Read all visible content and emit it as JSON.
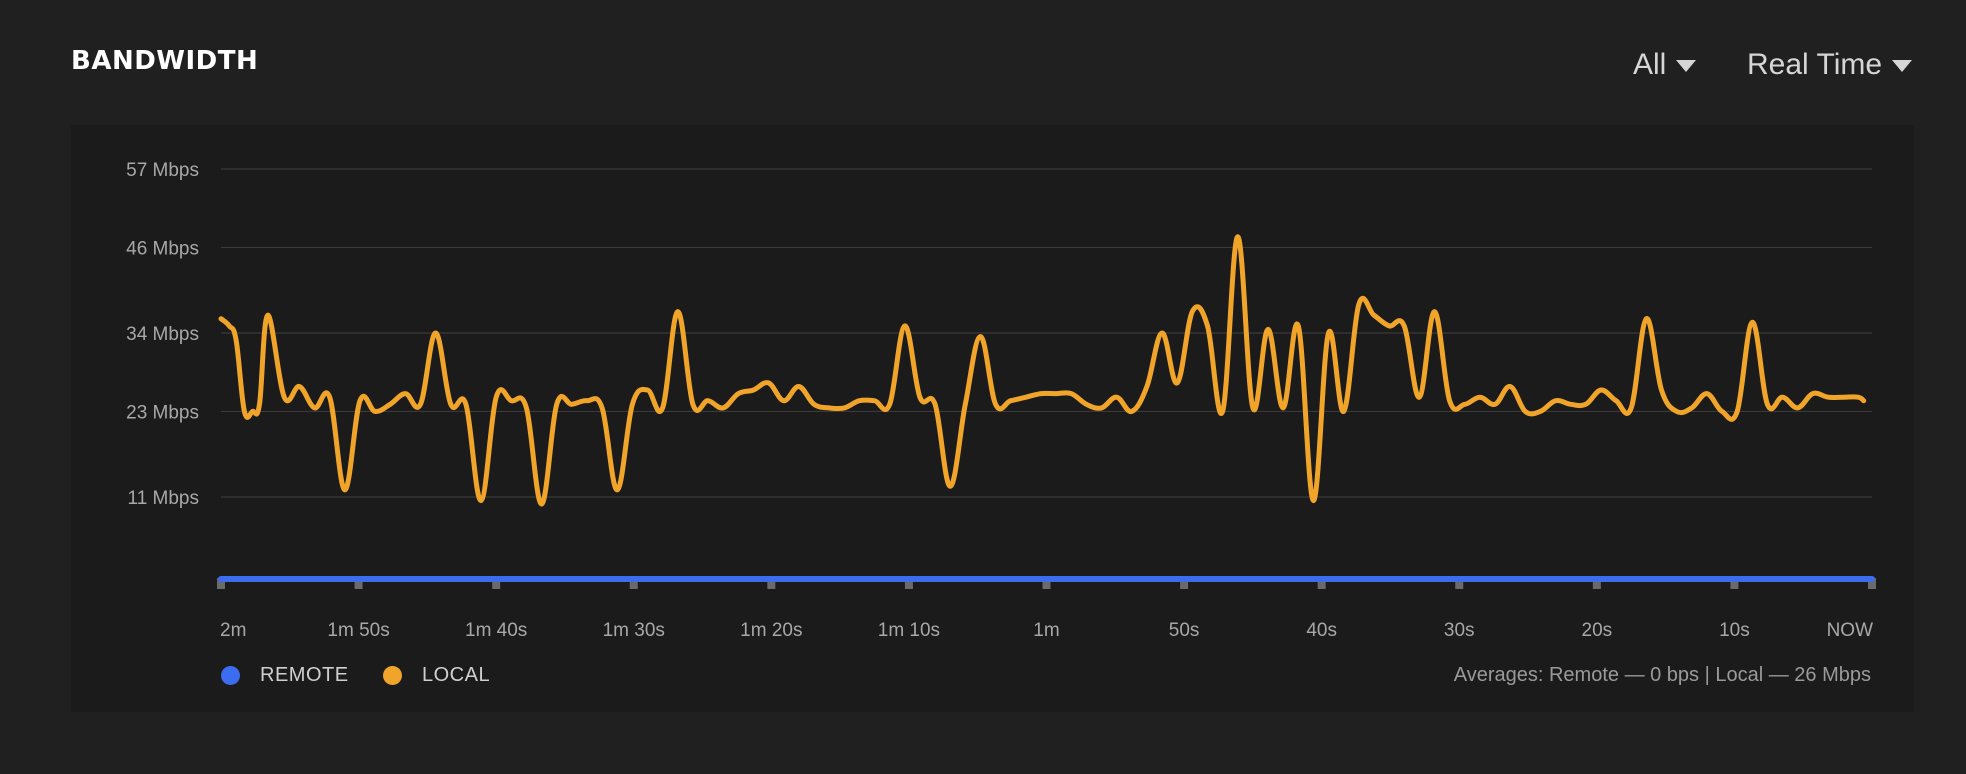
{
  "header": {
    "title": "BANDWIDTH",
    "filter_label": "All",
    "range_label": "Real Time"
  },
  "colors": {
    "remote": "#3c6df0",
    "local": "#f0a52a",
    "grid": "#3a3a3a",
    "tick_text": "#a8a8a8"
  },
  "footer": {
    "averages": "Averages: Remote — 0 bps | Local — 26 Mbps"
  },
  "chart_data": {
    "type": "line",
    "title": "BANDWIDTH",
    "xlabel": "",
    "ylabel": "",
    "x_range_seconds_ago": [
      120,
      0
    ],
    "ylim": [
      0,
      57
    ],
    "y_ticks": [
      {
        "value": 57,
        "label": "57 Mbps"
      },
      {
        "value": 46,
        "label": "46 Mbps"
      },
      {
        "value": 34,
        "label": "34 Mbps"
      },
      {
        "value": 23,
        "label": "23 Mbps"
      },
      {
        "value": 11,
        "label": "11 Mbps"
      }
    ],
    "x_ticks": [
      {
        "value": 120,
        "label": "2m"
      },
      {
        "value": 110,
        "label": "1m 50s"
      },
      {
        "value": 100,
        "label": "1m 40s"
      },
      {
        "value": 90,
        "label": "1m 30s"
      },
      {
        "value": 80,
        "label": "1m 20s"
      },
      {
        "value": 70,
        "label": "1m 10s"
      },
      {
        "value": 60,
        "label": "1m"
      },
      {
        "value": 50,
        "label": "50s"
      },
      {
        "value": 40,
        "label": "40s"
      },
      {
        "value": 30,
        "label": "30s"
      },
      {
        "value": 20,
        "label": "20s"
      },
      {
        "value": 10,
        "label": "10s"
      },
      {
        "value": 0,
        "label": "NOW"
      }
    ],
    "grid": true,
    "legend_position": "bottom-left",
    "series": [
      {
        "name": "REMOTE",
        "color": "#3c6df0",
        "values": [
          [
            120,
            0
          ],
          [
            0,
            0
          ]
        ]
      },
      {
        "name": "LOCAL",
        "color": "#f0a52a",
        "values": [
          [
            120,
            36
          ],
          [
            119.4,
            35
          ],
          [
            118.9,
            33
          ],
          [
            118.3,
            23
          ],
          [
            117.7,
            23
          ],
          [
            117.2,
            24
          ],
          [
            116.6,
            36.5
          ],
          [
            115.4,
            25
          ],
          [
            114.3,
            26.5
          ],
          [
            113.2,
            23.5
          ],
          [
            112.1,
            25
          ],
          [
            111,
            12
          ],
          [
            109.9,
            24.5
          ],
          [
            108.8,
            23
          ],
          [
            107.7,
            24
          ],
          [
            106.6,
            25.5
          ],
          [
            105.5,
            24
          ],
          [
            104.4,
            34
          ],
          [
            103.3,
            24
          ],
          [
            102.2,
            24
          ],
          [
            101.1,
            10.5
          ],
          [
            100,
            25
          ],
          [
            98.9,
            24.5
          ],
          [
            97.8,
            23.5
          ],
          [
            96.7,
            10
          ],
          [
            95.6,
            24
          ],
          [
            94.5,
            24
          ],
          [
            93.4,
            24.5
          ],
          [
            92.3,
            23.5
          ],
          [
            91.2,
            12
          ],
          [
            90.1,
            24
          ],
          [
            89,
            26
          ],
          [
            87.9,
            23.5
          ],
          [
            86.8,
            37
          ],
          [
            85.7,
            24
          ],
          [
            84.6,
            24.5
          ],
          [
            83.5,
            23.5
          ],
          [
            82.4,
            25.5
          ],
          [
            81.3,
            26
          ],
          [
            80.2,
            27
          ],
          [
            79.1,
            24.5
          ],
          [
            78,
            26.5
          ],
          [
            76.9,
            24
          ],
          [
            75.8,
            23.5
          ],
          [
            74.7,
            23.5
          ],
          [
            73.6,
            24.5
          ],
          [
            72.5,
            24.5
          ],
          [
            71.4,
            24
          ],
          [
            70.3,
            35
          ],
          [
            69.2,
            25
          ],
          [
            68.1,
            24
          ],
          [
            67,
            12.5
          ],
          [
            65.9,
            24
          ],
          [
            64.8,
            33.5
          ],
          [
            63.7,
            24
          ],
          [
            62.6,
            24.5
          ],
          [
            61.5,
            25
          ],
          [
            60.4,
            25.5
          ],
          [
            59.3,
            25.5
          ],
          [
            58.2,
            25.5
          ],
          [
            57.1,
            24
          ],
          [
            56,
            23.5
          ],
          [
            54.9,
            25
          ],
          [
            53.8,
            23
          ],
          [
            52.7,
            26.5
          ],
          [
            51.6,
            34
          ],
          [
            50.5,
            27
          ],
          [
            49.4,
            37
          ],
          [
            48.3,
            35
          ],
          [
            47.2,
            23
          ],
          [
            46.1,
            47.5
          ],
          [
            45,
            23.5
          ],
          [
            43.9,
            34.5
          ],
          [
            42.8,
            23.5
          ],
          [
            41.7,
            35
          ],
          [
            40.6,
            10.5
          ],
          [
            39.5,
            34
          ],
          [
            38.4,
            23
          ],
          [
            37.3,
            38
          ],
          [
            36.2,
            36.5
          ],
          [
            35.1,
            35
          ],
          [
            34,
            35
          ],
          [
            32.9,
            25
          ],
          [
            31.8,
            37
          ],
          [
            30.7,
            24.5
          ],
          [
            29.6,
            24
          ],
          [
            28.5,
            25
          ],
          [
            27.4,
            24
          ],
          [
            26.3,
            26.5
          ],
          [
            25.2,
            23
          ],
          [
            24.1,
            23
          ],
          [
            23,
            24.5
          ],
          [
            21.9,
            24
          ],
          [
            20.8,
            24
          ],
          [
            19.7,
            26
          ],
          [
            18.6,
            24.5
          ],
          [
            17.5,
            23.5
          ],
          [
            16.4,
            36
          ],
          [
            15.3,
            26
          ],
          [
            14.2,
            23
          ],
          [
            13.1,
            23.5
          ],
          [
            12,
            25.5
          ],
          [
            10.9,
            23
          ],
          [
            9.8,
            23
          ],
          [
            8.7,
            35.5
          ],
          [
            7.6,
            24
          ],
          [
            6.5,
            25
          ],
          [
            5.4,
            23.5
          ],
          [
            4.3,
            25.5
          ],
          [
            3.2,
            25
          ],
          [
            2.1,
            25
          ],
          [
            1,
            25
          ],
          [
            0.6,
            24.5
          ]
        ]
      }
    ]
  }
}
